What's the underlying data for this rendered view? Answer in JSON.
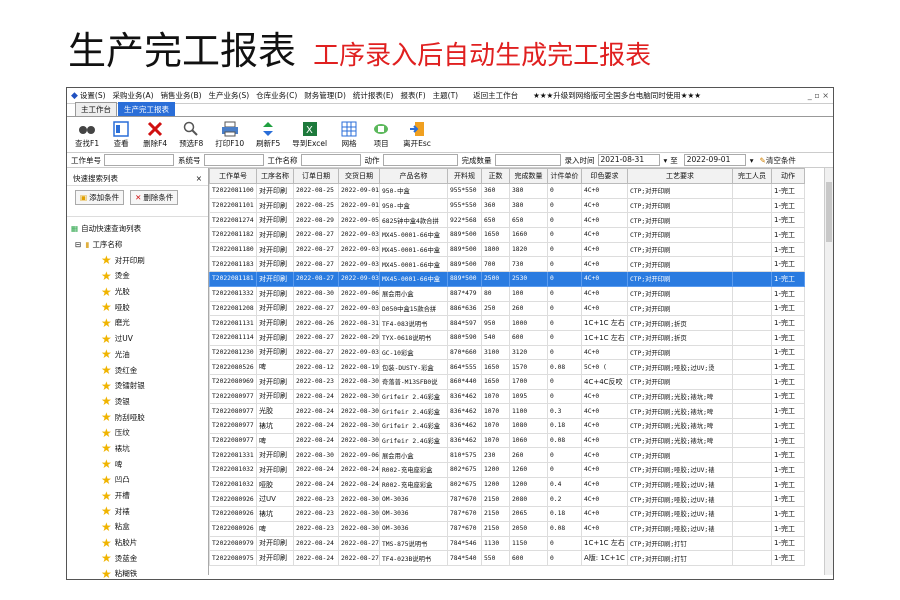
{
  "heading": {
    "title": "生产完工报表",
    "subtitle": "工序录入后自动生成完工报表"
  },
  "menubar": {
    "items": [
      "设置(S)",
      "采购业务(A)",
      "销售业务(B)",
      "生产业务(S)",
      "仓库业务(C)",
      "财务管理(D)",
      "统计报表(E)",
      "报表(F)",
      "主题(T)",
      "返回主工作台"
    ],
    "notice": "★★★升级到网络版可全国多台电脑同时使用★★★",
    "win": "_ ▫ ×"
  },
  "tabs": [
    "主工作台",
    "生产完工报表"
  ],
  "toolbar": [
    "查找F1",
    "查看",
    "删除F4",
    "预选F8",
    "打印F10",
    "刷新F5",
    "导到Excel",
    "网格",
    "项目",
    "离开Esc"
  ],
  "filter": {
    "order_no": "工作单号",
    "system_no": "系统号",
    "work_name": "工作名称",
    "action": "动作",
    "completed_qty": "完成数量",
    "entry_time": "录入时间",
    "date_from": "2021-08-31",
    "to": "至",
    "date_to": "2022-09-01",
    "clear": "清空条件"
  },
  "left": {
    "title": "快速搜索列表",
    "add": "添加条件",
    "delete": "删除条件",
    "root": "自动快速查询列表",
    "group": "工序名称",
    "items": [
      "对开印刷",
      "烫金",
      "光胶",
      "哑胶",
      "磨光",
      "过UV",
      "光油",
      "烫红金",
      "烫镭射银",
      "烫银",
      "防刮哑胶",
      "压纹",
      "裱坑",
      "啤",
      "凹凸",
      "开槽",
      "对裱",
      "粘盒",
      "粘胶片",
      "烫蓝金",
      "粘糊铁"
    ]
  },
  "table": {
    "headers": [
      "工作单号",
      "工序名称",
      "订单日期",
      "交货日期",
      "产品名称",
      "开料规",
      "正数",
      "完成数量",
      "计件单价",
      "印色要求",
      "工艺要求",
      "完工人员",
      "动作"
    ],
    "rows": [
      [
        "T2022081100",
        "对开印刷",
        "2022-08-25",
        "2022-09-01",
        "950-中盒",
        "955*550",
        "360",
        "380",
        "0",
        "4C+0",
        "CTP;对开印刷",
        "",
        "1-完工"
      ],
      [
        "T2022081101",
        "对开印刷",
        "2022-08-25",
        "2022-09-01",
        "950-中盒",
        "955*550",
        "360",
        "380",
        "0",
        "4C+0",
        "CTP;对开印刷",
        "",
        "1-完工"
      ],
      [
        "T2022081274",
        "对开印刷",
        "2022-08-29",
        "2022-09-05",
        "6825钟中盒4款合拼",
        "922*568",
        "650",
        "650",
        "0",
        "4C+0",
        "CTP;对开印刷",
        "",
        "1-完工"
      ],
      [
        "T2022081182",
        "对开印刷",
        "2022-08-27",
        "2022-09-03",
        "MX45-0001-66中盒",
        "889*500",
        "1650",
        "1660",
        "0",
        "4C+0",
        "CTP;对开印刷",
        "",
        "1-完工"
      ],
      [
        "T2022081180",
        "对开印刷",
        "2022-08-27",
        "2022-09-03",
        "MX45-0001-66中盒",
        "889*500",
        "1800",
        "1820",
        "0",
        "4C+0",
        "CTP;对开印刷",
        "",
        "1-完工"
      ],
      [
        "T2022081183",
        "对开印刷",
        "2022-08-27",
        "2022-09-03",
        "MX45-0001-66中盒",
        "889*500",
        "700",
        "730",
        "0",
        "4C+0",
        "CTP;对开印刷",
        "",
        "1-完工"
      ],
      [
        "T2022081181",
        "对开印刷",
        "2022-08-27",
        "2022-09-03",
        "MX45-0001-66中盒",
        "889*500",
        "2500",
        "2530",
        "0",
        "4C+0",
        "CTP;对开印刷",
        "",
        "1-完工"
      ],
      [
        "T2022081332",
        "对开印刷",
        "2022-08-30",
        "2022-09-06",
        "展会用小盒",
        "887*479",
        "80",
        "100",
        "0",
        "4C+0",
        "CTP;对开印刷",
        "",
        "1-完工"
      ],
      [
        "T2022081208",
        "对开印刷",
        "2022-08-27",
        "2022-09-03",
        "D050中盒15款合拼",
        "886*636",
        "250",
        "260",
        "0",
        "4C+0",
        "CTP;对开印刷",
        "",
        "1-完工"
      ],
      [
        "T2022081131",
        "对开印刷",
        "2022-08-26",
        "2022-08-31",
        "TF4-083说明书",
        "884*597",
        "950",
        "1000",
        "0",
        "1C+1C 左右",
        "CTP;对开印刷;折页",
        "",
        "1-完工"
      ],
      [
        "T2022081114",
        "对开印刷",
        "2022-08-27",
        "2022-08-29",
        "TYX-0618说明书",
        "880*590",
        "540",
        "600",
        "0",
        "1C+1C 左右",
        "CTP;对开印刷;折页",
        "",
        "1-完工"
      ],
      [
        "T2022081230",
        "对开印刷",
        "2022-08-27",
        "2022-09-03",
        "GC-10彩盒",
        "870*660",
        "3100",
        "3120",
        "0",
        "4C+0",
        "CTP;对开印刷",
        "",
        "1-完工"
      ],
      [
        "T2022080526",
        "啤",
        "2022-08-12",
        "2022-08-19",
        "包装-DUSTY-彩盒",
        "864*555",
        "1650",
        "1570",
        "0.08",
        "5C+0 (",
        "CTP;对开印刷;哑胶;过UV;烫",
        "",
        "1-完工"
      ],
      [
        "T2022080969",
        "对开印刷",
        "2022-08-23",
        "2022-08-30",
        "奇落普-M13SFB0说",
        "860*440",
        "1650",
        "1700",
        "0",
        "4C+4C反咬",
        "CTP;对开印刷",
        "",
        "1-完工"
      ],
      [
        "T2022080977",
        "对开印刷",
        "2022-08-24",
        "2022-08-30",
        "Grifeir 2.4G彩盒",
        "836*462",
        "1070",
        "1095",
        "0",
        "4C+0",
        "CTP;对开印刷;光胶;裱坑;啤",
        "",
        "1-完工"
      ],
      [
        "T2022080977",
        "光胶",
        "2022-08-24",
        "2022-08-30",
        "Grifeir 2.4G彩盒",
        "836*462",
        "1070",
        "1100",
        "0.3",
        "4C+0",
        "CTP;对开印刷;光胶;裱坑;啤",
        "",
        "1-完工"
      ],
      [
        "T2022080977",
        "裱坑",
        "2022-08-24",
        "2022-08-30",
        "Grifeir 2.4G彩盒",
        "836*462",
        "1070",
        "1080",
        "0.18",
        "4C+0",
        "CTP;对开印刷;光胶;裱坑;啤",
        "",
        "1-完工"
      ],
      [
        "T2022080977",
        "啤",
        "2022-08-24",
        "2022-08-30",
        "Grifeir 2.4G彩盒",
        "836*462",
        "1070",
        "1060",
        "0.08",
        "4C+0",
        "CTP;对开印刷;光胶;裱坑;啤",
        "",
        "1-完工"
      ],
      [
        "T2022081331",
        "对开印刷",
        "2022-08-30",
        "2022-09-06",
        "展会用小盒",
        "810*575",
        "230",
        "260",
        "0",
        "4C+0",
        "CTP;对开印刷",
        "",
        "1-完工"
      ],
      [
        "T2022081032",
        "对开印刷",
        "2022-08-24",
        "2022-08-24",
        "R002-充电座彩盒",
        "802*675",
        "1200",
        "1260",
        "0",
        "4C+0",
        "CTP;对开印刷;哑胶;过UV;裱",
        "",
        "1-完工"
      ],
      [
        "T2022081032",
        "哑胶",
        "2022-08-24",
        "2022-08-24",
        "R002-充电座彩盒",
        "802*675",
        "1200",
        "1200",
        "0.4",
        "4C+0",
        "CTP;对开印刷;哑胶;过UV;裱",
        "",
        "1-完工"
      ],
      [
        "T2022080926",
        "过UV",
        "2022-08-23",
        "2022-08-30",
        "OM-3036",
        "787*670",
        "2150",
        "2080",
        "0.2",
        "4C+0",
        "CTP;对开印刷;哑胶;过UV;裱",
        "",
        "1-完工"
      ],
      [
        "T2022080926",
        "裱坑",
        "2022-08-23",
        "2022-08-30",
        "OM-3036",
        "787*670",
        "2150",
        "2065",
        "0.18",
        "4C+0",
        "CTP;对开印刷;哑胶;过UV;裱",
        "",
        "1-完工"
      ],
      [
        "T2022080926",
        "啤",
        "2022-08-23",
        "2022-08-30",
        "OM-3036",
        "787*670",
        "2150",
        "2050",
        "0.08",
        "4C+0",
        "CTP;对开印刷;哑胶;过UV;裱",
        "",
        "1-完工"
      ],
      [
        "T2022080979",
        "对开印刷",
        "2022-08-24",
        "2022-08-27",
        "TMS-875说明书",
        "784*546",
        "1130",
        "1150",
        "0",
        "1C+1C 左右",
        "CTP;对开印刷;打钉",
        "",
        "1-完工"
      ],
      [
        "T2022080975",
        "对开印刷",
        "2022-08-24",
        "2022-08-27",
        "TF4-023B说明书",
        "784*540",
        "550",
        "600",
        "0",
        "A版: 1C+1C",
        "CTP;对开印刷;打钉",
        "",
        "1-完工"
      ]
    ],
    "selected_row": 6
  }
}
